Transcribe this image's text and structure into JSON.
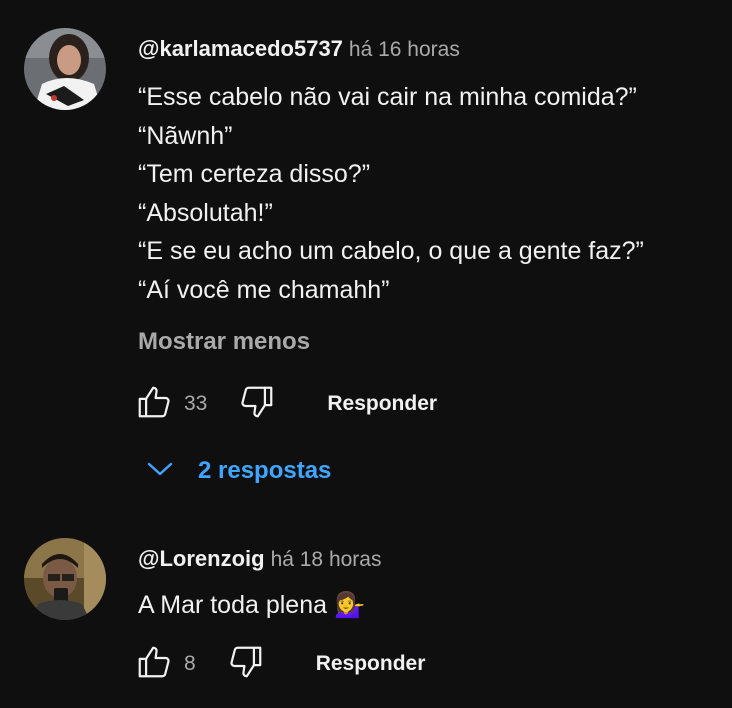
{
  "comments": [
    {
      "author": "@karlamacedo5737",
      "time": "há 16 horas",
      "lines": [
        "“Esse cabelo não vai cair na minha comida?”",
        "“Nãwnh”",
        "“Tem certeza disso?”",
        "“Absolutah!”",
        "“E se eu acho um cabelo, o que a gente faz?”",
        "“Aí você me chamahh”"
      ],
      "show_less": "Mostrar menos",
      "likes": "33",
      "reply_label": "Responder",
      "replies_label": "2 respostas"
    },
    {
      "author": "@Lorenzoig",
      "time": "há 18 horas",
      "text": "A Mar toda plena 💁‍♀️",
      "likes": "8",
      "reply_label": "Responder"
    }
  ],
  "colors": {
    "background": "#0f0f0f",
    "text": "#f1f1f1",
    "secondary": "#aaaaaa",
    "link": "#3ea6ff"
  },
  "icons": [
    "thumb-up-icon",
    "thumb-down-icon",
    "chevron-down-icon"
  ]
}
